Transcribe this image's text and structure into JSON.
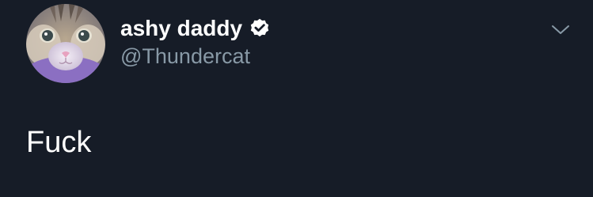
{
  "tweet": {
    "author": {
      "display_name": "ashy daddy",
      "handle": "@Thundercat",
      "verified": true,
      "avatar_icon": "cat-face-avatar"
    },
    "text": "Fuck",
    "menu_icon": "chevron-down-icon"
  },
  "colors": {
    "background": "#161c27",
    "name": "#ffffff",
    "handle": "#8899a6",
    "text": "#ffffff",
    "caret": "#8899a6"
  }
}
